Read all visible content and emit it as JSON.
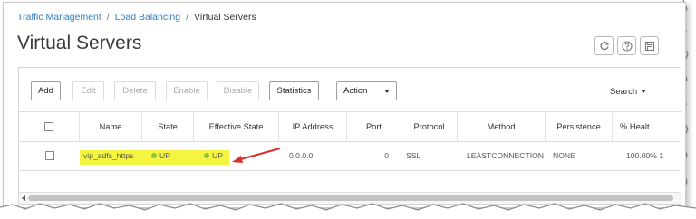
{
  "breadcrumb": {
    "items": [
      "Traffic Management",
      "Load Balancing",
      "Virtual Servers"
    ],
    "separator": "/"
  },
  "page": {
    "title": "Virtual Servers"
  },
  "top_icons": [
    "refresh-icon",
    "help-icon",
    "save-icon"
  ],
  "toolbar": {
    "buttons": [
      "Add",
      "Edit",
      "Delete",
      "Enable",
      "Disable",
      "Statistics"
    ],
    "action": "Action",
    "search": "Search"
  },
  "table": {
    "columns": [
      "Name",
      "State",
      "Effective State",
      "IP Address",
      "Port",
      "Protocol",
      "Method",
      "Persistence",
      "% Healt"
    ],
    "rows": [
      {
        "name": "vip_adfs_https",
        "state": "UP",
        "effective_state": "UP",
        "ip_address": "0.0.0.0",
        "port": "0",
        "protocol": "SSL",
        "method": "LEASTCONNECTION",
        "persistence": "NONE",
        "health": "100.00% 1"
      }
    ]
  },
  "colors": {
    "link": "#2f7cc2",
    "highlight": "#f5f541",
    "status_up": "#8cc63f",
    "annotation_arrow": "#d9302c"
  }
}
